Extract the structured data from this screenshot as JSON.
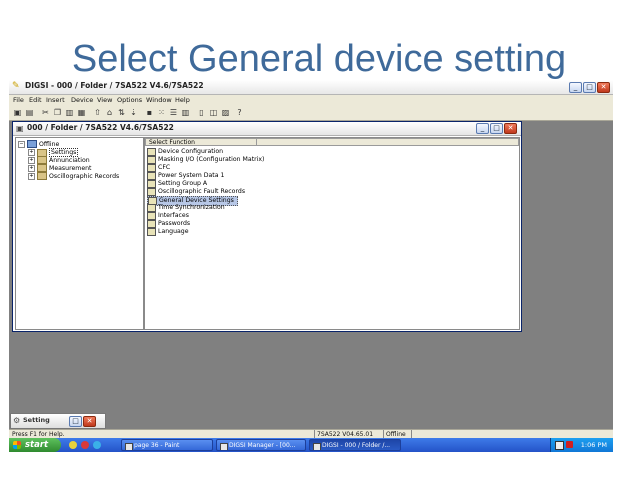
{
  "slide": {
    "title": "Select General device setting"
  },
  "app": {
    "title": "DIGSI - 000 / Folder / 7SA522 V4.6/7SA522",
    "window_buttons": [
      "_",
      "□",
      "✕"
    ]
  },
  "menu": [
    "File",
    "Edit",
    "Insert",
    "Device",
    "View",
    "Options",
    "Window",
    "Help"
  ],
  "child_window": {
    "title": "000 / Folder / 7SA522 V4.6/7SA522",
    "tree": [
      {
        "label": "Offline",
        "level": 0
      },
      {
        "label": "Settings",
        "level": 1,
        "selected": true
      },
      {
        "label": "Annunciation",
        "level": 1
      },
      {
        "label": "Measurement",
        "level": 1
      },
      {
        "label": "Oscillographic Records",
        "level": 1
      }
    ],
    "function_header": "Select Function",
    "functions": [
      "Device Configuration",
      "Masking I/O (Configuration Matrix)",
      "CFC",
      "Power System Data 1",
      "Setting Group A",
      "Oscillographic Fault Records",
      "General Device Settings",
      "Time Synchronization",
      "Interfaces",
      "Passwords",
      "Language"
    ],
    "selected_function": "General Device Settings"
  },
  "minimized_window": {
    "title": "Setting"
  },
  "status": {
    "help": "Press F1 for Help.",
    "version": "7SA522  V04.65.01",
    "mode": "Offline"
  },
  "taskbar": {
    "start": "start",
    "tasks": [
      "page 36 - Paint",
      "DIGSI Manager - [00...",
      "DIGSI - 000 / Folder /..."
    ],
    "clock": "1:06 PM"
  },
  "colors": {
    "title": "#3f6a9a",
    "taskbar": "#2453c8",
    "selection": "#b7c7e6"
  }
}
